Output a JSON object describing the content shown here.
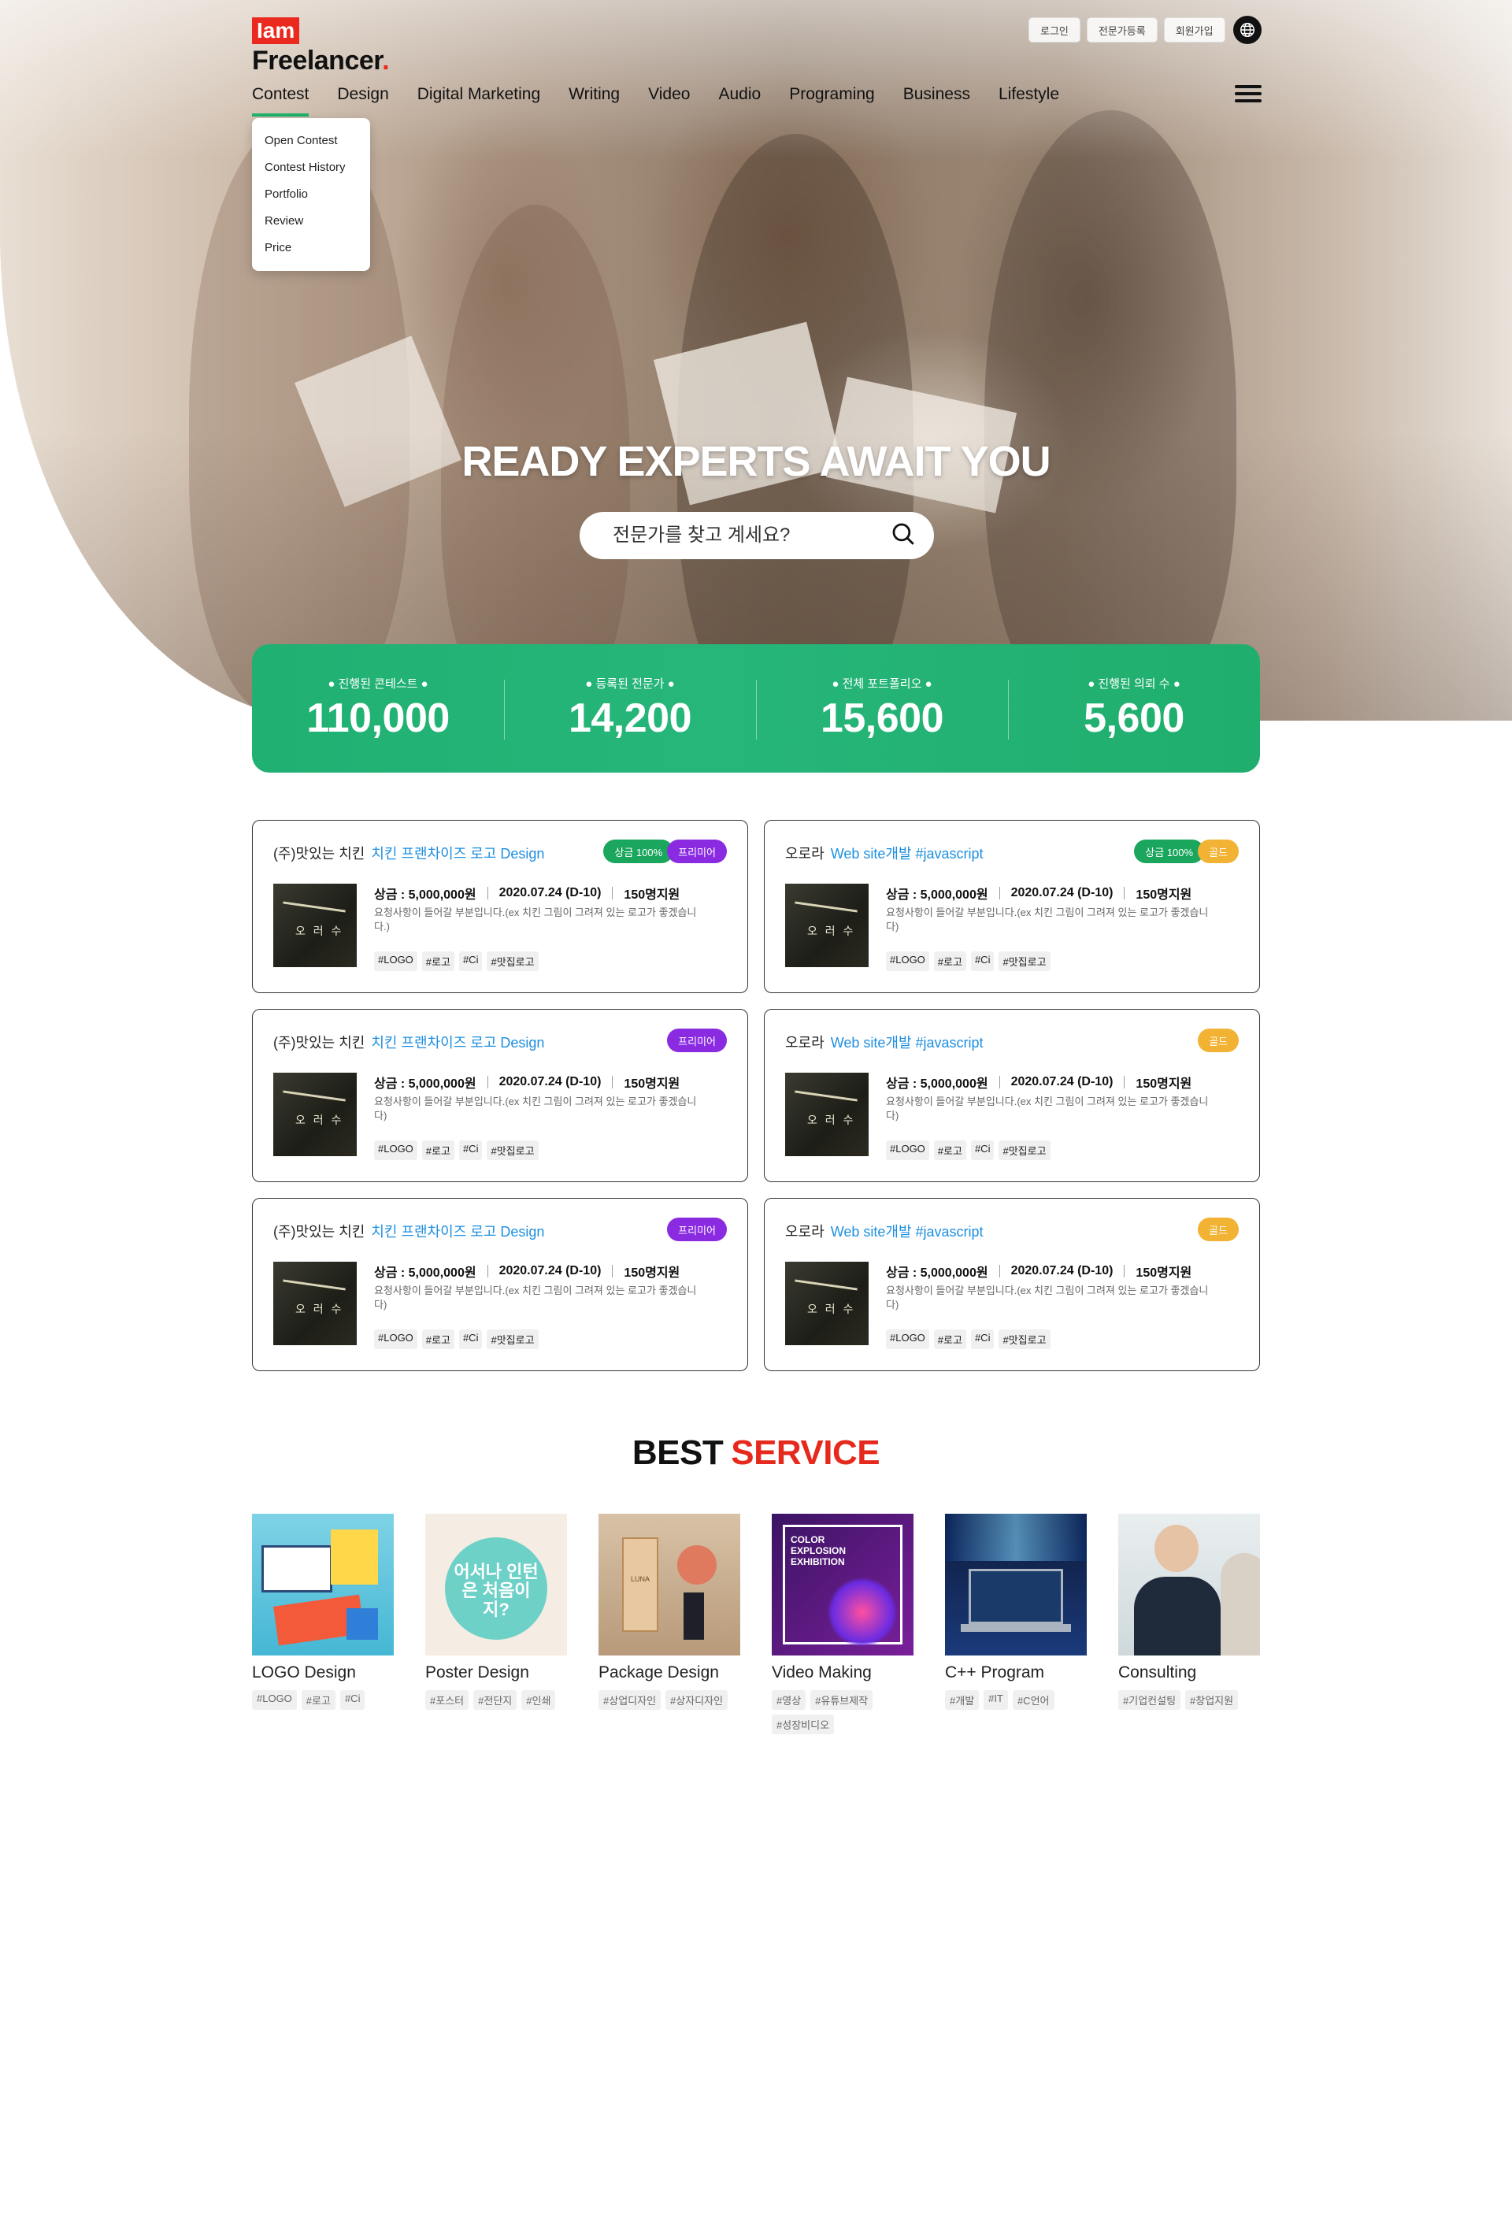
{
  "header": {
    "logo_iam": "Iam",
    "logo_name": "Freelancer",
    "logo_dot": ".",
    "utility": [
      "로그인",
      "전문가등록",
      "회원가입"
    ],
    "globe_icon": "globe-icon",
    "menu_icon": "hamburger-menu-icon"
  },
  "nav": {
    "items": [
      "Contest",
      "Design",
      "Digital Marketing",
      "Writing",
      "Video",
      "Audio",
      "Programing",
      "Business",
      "Lifestyle"
    ],
    "active": "Contest",
    "accent_color": "#1db36b"
  },
  "dropdown": {
    "items": [
      "Open Contest",
      "Contest History",
      "Portfolio",
      "Review",
      "Price"
    ]
  },
  "hero": {
    "title": "READY EXPERTS AWAIT YOU",
    "search_placeholder": "전문가를 찾고 계세요?",
    "search_icon": "search-icon"
  },
  "stats": [
    {
      "label": "● 진행된 콘테스트 ●",
      "value": "110,000"
    },
    {
      "label": "● 등록된 전문가 ●",
      "value": "14,200"
    },
    {
      "label": "● 전체 포트폴리오 ●",
      "value": "15,600"
    },
    {
      "label": "● 진행된 의뢰 수 ●",
      "value": "5,600"
    }
  ],
  "contests": [
    {
      "company": "(주)맛있는 치킨",
      "title": "치킨 프랜차이즈 로고 Design",
      "badges": [
        {
          "text": "상금 100%",
          "color": "green"
        },
        {
          "text": "프리미어",
          "color": "purple"
        }
      ],
      "prize": "상금 : 5,000,000원",
      "date": "2020.07.24 (D-10)",
      "applicants": "150명지원",
      "desc": "요청사항이 들어갈 부분입니다.(ex 치킨 그림이 그려져 있는 로고가 좋겠습니다.)",
      "tags": [
        "#LOGO",
        "#로고",
        "#Ci",
        "#맛집로고"
      ],
      "thumb_text": "오 러 수"
    },
    {
      "company": "오로라",
      "title": "Web site개발 #javascript",
      "badges": [
        {
          "text": "상금 100%",
          "color": "green"
        },
        {
          "text": "골드",
          "color": "gold"
        }
      ],
      "prize": "상금 : 5,000,000원",
      "date": "2020.07.24 (D-10)",
      "applicants": "150명지원",
      "desc": "요청사항이 들어갈 부분입니다.(ex 치킨 그림이 그려져 있는 로고가 좋겠습니다)",
      "tags": [
        "#LOGO",
        "#로고",
        "#Ci",
        "#맛집로고"
      ],
      "thumb_text": "오 러 수"
    },
    {
      "company": "(주)맛있는 치킨",
      "title": "치킨 프랜차이즈 로고 Design",
      "badges": [
        {
          "text": "프리미어",
          "color": "purple"
        }
      ],
      "prize": "상금 : 5,000,000원",
      "date": "2020.07.24 (D-10)",
      "applicants": "150명지원",
      "desc": "요청사항이 들어갈 부분입니다.(ex 치킨 그림이 그려져 있는 로고가 좋겠습니다)",
      "tags": [
        "#LOGO",
        "#로고",
        "#Ci",
        "#맛집로고"
      ],
      "thumb_text": "오 러 수"
    },
    {
      "company": "오로라",
      "title": "Web site개발 #javascript",
      "badges": [
        {
          "text": "골드",
          "color": "gold"
        }
      ],
      "prize": "상금 : 5,000,000원",
      "date": "2020.07.24 (D-10)",
      "applicants": "150명지원",
      "desc": "요청사항이 들어갈 부분입니다.(ex 치킨 그림이 그려져 있는 로고가 좋겠습니다)",
      "tags": [
        "#LOGO",
        "#로고",
        "#Ci",
        "#맛집로고"
      ],
      "thumb_text": "오 러 수"
    },
    {
      "company": "(주)맛있는 치킨",
      "title": "치킨 프랜차이즈 로고 Design",
      "badges": [
        {
          "text": "프리미어",
          "color": "purple"
        }
      ],
      "prize": "상금 : 5,000,000원",
      "date": "2020.07.24 (D-10)",
      "applicants": "150명지원",
      "desc": "요청사항이 들어갈 부분입니다.(ex 치킨 그림이 그려져 있는 로고가 좋겠습니다)",
      "tags": [
        "#LOGO",
        "#로고",
        "#Ci",
        "#맛집로고"
      ],
      "thumb_text": "오 러 수"
    },
    {
      "company": "오로라",
      "title": "Web site개발 #javascript",
      "badges": [
        {
          "text": "골드",
          "color": "gold"
        }
      ],
      "prize": "상금 : 5,000,000원",
      "date": "2020.07.24 (D-10)",
      "applicants": "150명지원",
      "desc": "요청사항이 들어갈 부분입니다.(ex 치킨 그림이 그려져 있는 로고가 좋겠습니다)",
      "tags": [
        "#LOGO",
        "#로고",
        "#Ci",
        "#맛집로고"
      ],
      "thumb_text": "오 러 수"
    }
  ],
  "best": {
    "title_black": "BEST",
    "title_red": "SERVICE",
    "services": [
      {
        "name": "LOGO Design",
        "tags": [
          "#LOGO",
          "#로고",
          "#Ci"
        ],
        "img": "logo"
      },
      {
        "name": "Poster Design",
        "tags": [
          "#포스터",
          "#전단지",
          "#인쇄"
        ],
        "img": "poster",
        "img_text": "어서나 인턴은 처음이지?"
      },
      {
        "name": "Package Design",
        "tags": [
          "#상업디자인",
          "#상자디자인"
        ],
        "img": "package",
        "img_text": "LUNA"
      },
      {
        "name": "Video Making",
        "tags": [
          "#영상",
          "#유튜브제작",
          "#성장비디오"
        ],
        "img": "video",
        "img_text": "COLOR EXPLOSION EXHIBITION"
      },
      {
        "name": "C++ Program",
        "tags": [
          "#개발",
          "#IT",
          "#C언어"
        ],
        "img": "cpp"
      },
      {
        "name": "Consulting",
        "tags": [
          "#기업컨설팅",
          "#창업지원"
        ],
        "img": "consult"
      }
    ]
  }
}
